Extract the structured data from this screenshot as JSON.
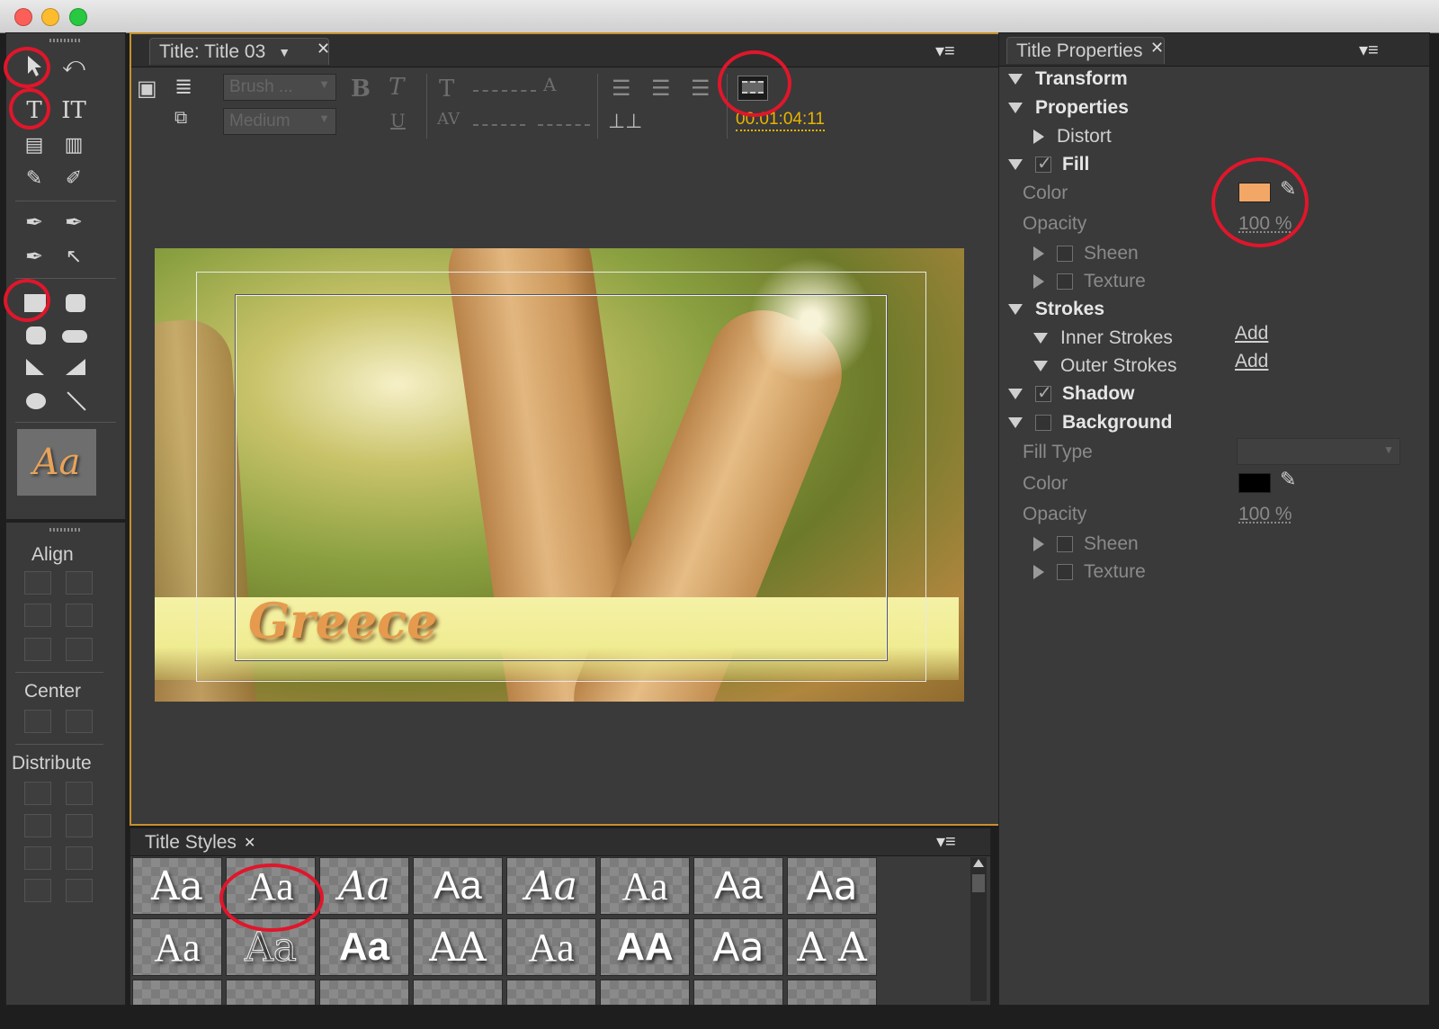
{
  "editor": {
    "tab_title": "Title: Title 03",
    "font_family_placeholder": "Brush ...",
    "font_style_placeholder": "Medium",
    "timecode": "00:01:04:11",
    "canvas_text": "Greece",
    "bold_btn": "B",
    "italic_btn": "T",
    "underline_btn": "U"
  },
  "tools": {
    "title_text_icon": "Aa",
    "align_label": "Align",
    "center_label": "Center",
    "distribute_label": "Distribute"
  },
  "properties": {
    "panel_title": "Title Properties",
    "transform": "Transform",
    "properties": "Properties",
    "distort": "Distort",
    "fill": "Fill",
    "fill_color_label": "Color",
    "fill_color": "#f3a766",
    "fill_opacity_label": "Opacity",
    "fill_opacity": "100 %",
    "sheen": "Sheen",
    "texture": "Texture",
    "strokes": "Strokes",
    "inner_strokes": "Inner Strokes",
    "outer_strokes": "Outer Strokes",
    "add_inner": "Add",
    "add_outer": "Add",
    "shadow": "Shadow",
    "background": "Background",
    "fill_type_label": "Fill Type",
    "bg_color_label": "Color",
    "bg_color": "#000000",
    "bg_opacity_label": "Opacity",
    "bg_opacity": "100 %",
    "bg_sheen": "Sheen",
    "bg_texture": "Texture"
  },
  "styles": {
    "panel_title": "Title Styles",
    "row1": [
      "Aa",
      "Aa",
      "Aa",
      "Aa",
      "Aa",
      "Aa",
      "Aa",
      "Aa"
    ],
    "row2": [
      "Aa",
      "Aa",
      "Aa",
      "AA",
      "Aa",
      "AA",
      "Aa",
      "A A"
    ]
  },
  "colors": {
    "accent_border": "#c8902c",
    "highlight": "#e0162b",
    "timecode": "#e8b400"
  }
}
